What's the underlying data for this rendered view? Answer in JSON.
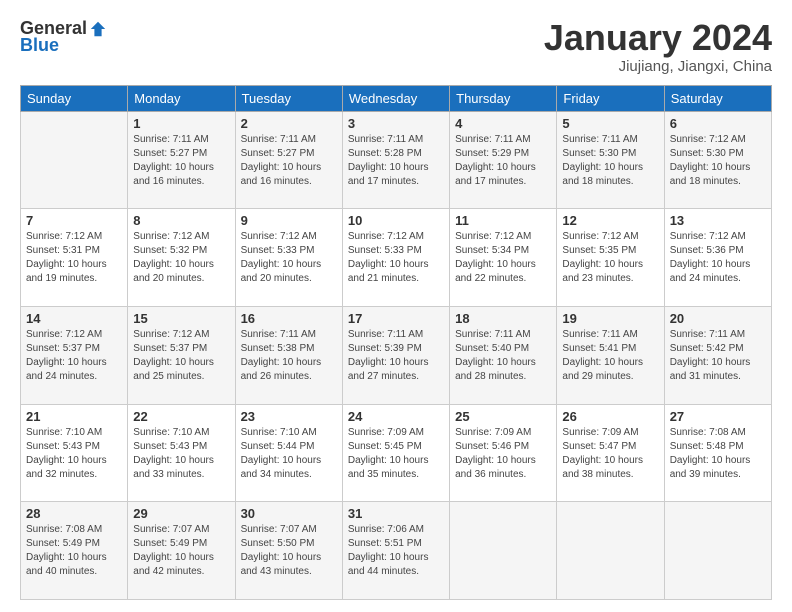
{
  "header": {
    "logo": {
      "general": "General",
      "blue": "Blue"
    },
    "title": "January 2024",
    "location": "Jiujiang, Jiangxi, China"
  },
  "calendar": {
    "days_of_week": [
      "Sunday",
      "Monday",
      "Tuesday",
      "Wednesday",
      "Thursday",
      "Friday",
      "Saturday"
    ],
    "weeks": [
      [
        {
          "date": "",
          "info": ""
        },
        {
          "date": "1",
          "info": "Sunrise: 7:11 AM\nSunset: 5:27 PM\nDaylight: 10 hours\nand 16 minutes."
        },
        {
          "date": "2",
          "info": "Sunrise: 7:11 AM\nSunset: 5:27 PM\nDaylight: 10 hours\nand 16 minutes."
        },
        {
          "date": "3",
          "info": "Sunrise: 7:11 AM\nSunset: 5:28 PM\nDaylight: 10 hours\nand 17 minutes."
        },
        {
          "date": "4",
          "info": "Sunrise: 7:11 AM\nSunset: 5:29 PM\nDaylight: 10 hours\nand 17 minutes."
        },
        {
          "date": "5",
          "info": "Sunrise: 7:11 AM\nSunset: 5:30 PM\nDaylight: 10 hours\nand 18 minutes."
        },
        {
          "date": "6",
          "info": "Sunrise: 7:12 AM\nSunset: 5:30 PM\nDaylight: 10 hours\nand 18 minutes."
        }
      ],
      [
        {
          "date": "7",
          "info": "Sunrise: 7:12 AM\nSunset: 5:31 PM\nDaylight: 10 hours\nand 19 minutes."
        },
        {
          "date": "8",
          "info": "Sunrise: 7:12 AM\nSunset: 5:32 PM\nDaylight: 10 hours\nand 20 minutes."
        },
        {
          "date": "9",
          "info": "Sunrise: 7:12 AM\nSunset: 5:33 PM\nDaylight: 10 hours\nand 20 minutes."
        },
        {
          "date": "10",
          "info": "Sunrise: 7:12 AM\nSunset: 5:33 PM\nDaylight: 10 hours\nand 21 minutes."
        },
        {
          "date": "11",
          "info": "Sunrise: 7:12 AM\nSunset: 5:34 PM\nDaylight: 10 hours\nand 22 minutes."
        },
        {
          "date": "12",
          "info": "Sunrise: 7:12 AM\nSunset: 5:35 PM\nDaylight: 10 hours\nand 23 minutes."
        },
        {
          "date": "13",
          "info": "Sunrise: 7:12 AM\nSunset: 5:36 PM\nDaylight: 10 hours\nand 24 minutes."
        }
      ],
      [
        {
          "date": "14",
          "info": "Sunrise: 7:12 AM\nSunset: 5:37 PM\nDaylight: 10 hours\nand 24 minutes."
        },
        {
          "date": "15",
          "info": "Sunrise: 7:12 AM\nSunset: 5:37 PM\nDaylight: 10 hours\nand 25 minutes."
        },
        {
          "date": "16",
          "info": "Sunrise: 7:11 AM\nSunset: 5:38 PM\nDaylight: 10 hours\nand 26 minutes."
        },
        {
          "date": "17",
          "info": "Sunrise: 7:11 AM\nSunset: 5:39 PM\nDaylight: 10 hours\nand 27 minutes."
        },
        {
          "date": "18",
          "info": "Sunrise: 7:11 AM\nSunset: 5:40 PM\nDaylight: 10 hours\nand 28 minutes."
        },
        {
          "date": "19",
          "info": "Sunrise: 7:11 AM\nSunset: 5:41 PM\nDaylight: 10 hours\nand 29 minutes."
        },
        {
          "date": "20",
          "info": "Sunrise: 7:11 AM\nSunset: 5:42 PM\nDaylight: 10 hours\nand 31 minutes."
        }
      ],
      [
        {
          "date": "21",
          "info": "Sunrise: 7:10 AM\nSunset: 5:43 PM\nDaylight: 10 hours\nand 32 minutes."
        },
        {
          "date": "22",
          "info": "Sunrise: 7:10 AM\nSunset: 5:43 PM\nDaylight: 10 hours\nand 33 minutes."
        },
        {
          "date": "23",
          "info": "Sunrise: 7:10 AM\nSunset: 5:44 PM\nDaylight: 10 hours\nand 34 minutes."
        },
        {
          "date": "24",
          "info": "Sunrise: 7:09 AM\nSunset: 5:45 PM\nDaylight: 10 hours\nand 35 minutes."
        },
        {
          "date": "25",
          "info": "Sunrise: 7:09 AM\nSunset: 5:46 PM\nDaylight: 10 hours\nand 36 minutes."
        },
        {
          "date": "26",
          "info": "Sunrise: 7:09 AM\nSunset: 5:47 PM\nDaylight: 10 hours\nand 38 minutes."
        },
        {
          "date": "27",
          "info": "Sunrise: 7:08 AM\nSunset: 5:48 PM\nDaylight: 10 hours\nand 39 minutes."
        }
      ],
      [
        {
          "date": "28",
          "info": "Sunrise: 7:08 AM\nSunset: 5:49 PM\nDaylight: 10 hours\nand 40 minutes."
        },
        {
          "date": "29",
          "info": "Sunrise: 7:07 AM\nSunset: 5:49 PM\nDaylight: 10 hours\nand 42 minutes."
        },
        {
          "date": "30",
          "info": "Sunrise: 7:07 AM\nSunset: 5:50 PM\nDaylight: 10 hours\nand 43 minutes."
        },
        {
          "date": "31",
          "info": "Sunrise: 7:06 AM\nSunset: 5:51 PM\nDaylight: 10 hours\nand 44 minutes."
        },
        {
          "date": "",
          "info": ""
        },
        {
          "date": "",
          "info": ""
        },
        {
          "date": "",
          "info": ""
        }
      ]
    ]
  }
}
